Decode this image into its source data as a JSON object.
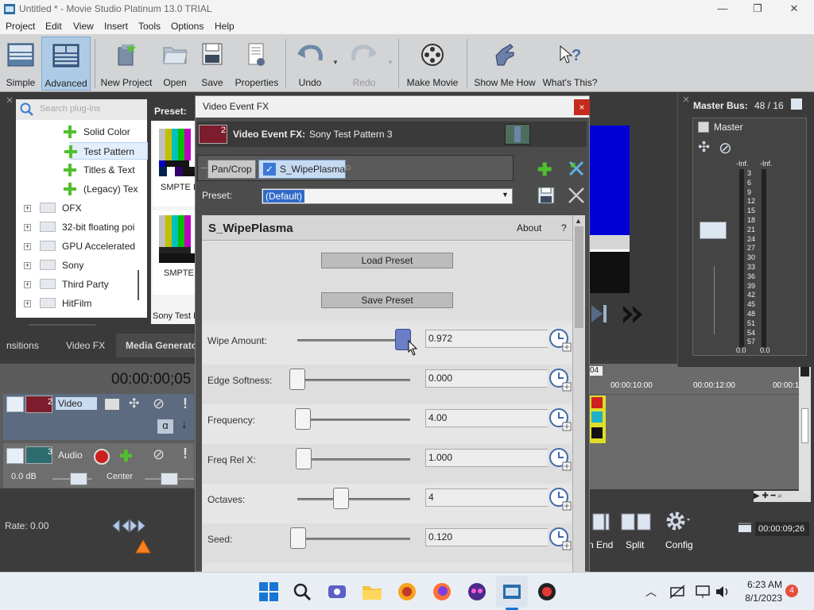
{
  "window": {
    "title": "Untitled * - Movie Studio Platinum 13.0 TRIAL",
    "controls": [
      "—",
      "❐",
      "✕"
    ]
  },
  "menu": [
    "Project",
    "Edit",
    "View",
    "Insert",
    "Tools",
    "Options",
    "Help"
  ],
  "toolbar": {
    "simple": "Simple",
    "advanced": "Advanced",
    "new_project": "New Project",
    "open": "Open",
    "save": "Save",
    "properties": "Properties",
    "undo": "Undo",
    "redo": "Redo",
    "make_movie": "Make Movie",
    "show_me_how": "Show Me How",
    "whats_this": "What's This?"
  },
  "plugins": {
    "search_placeholder": "Search plug-ins",
    "items": [
      "Solid Color",
      "Test Pattern",
      "Titles & Text",
      "(Legacy) Tex"
    ],
    "folders": [
      "OFX",
      "32-bit floating poi",
      "GPU Accelerated",
      "Sony",
      "Third Party",
      "HitFilm"
    ]
  },
  "presets_panel": {
    "label": "Preset:",
    "thumb1": "SMPTE B",
    "thumb2": "SMPTE B",
    "thumb3": "Sony Test F"
  },
  "tabs": [
    "nsitions",
    "Video FX",
    "Media Generato"
  ],
  "timeline": {
    "timecode": "00:00:00;05",
    "video_track_num": "2",
    "video_track_name": "Video",
    "audio_track_num": "3",
    "audio_track_name": "Audio",
    "volume": "0.0 dB",
    "pan": "Center",
    "alpha": "α"
  },
  "rate": "Rate: 0.00",
  "right_timeline": {
    "ruler_left": "04",
    "t1": "00:00:10:00",
    "t2": "00:00:12:00",
    "t3": "00:00:1",
    "end_timecode": "00:00:09;26"
  },
  "bottom_tools": {
    "end_label": "n End",
    "split_label": "Split",
    "config_label": "Config"
  },
  "master_bus": {
    "title": "Master Bus:",
    "count": "48 / 16",
    "master_label": "Master",
    "inf_left": "-Inf.",
    "inf_right": "-Inf.",
    "scale": [
      "3",
      "6",
      "9",
      "12",
      "15",
      "18",
      "21",
      "24",
      "27",
      "30",
      "33",
      "36",
      "39",
      "42",
      "45",
      "48",
      "51",
      "54",
      "57"
    ],
    "floor_left": "0.0",
    "floor_right": "0.0"
  },
  "dialog": {
    "title": "Video Event FX",
    "close": "×",
    "event_num": "2",
    "event_label": "Video Event FX:",
    "event_name": "Sony Test Pattern 3",
    "chain_pan_crop": "Pan/Crop",
    "chain_plugin": "S_WipePlasma",
    "preset_label": "Preset:",
    "preset_value": "(Default)",
    "plugin_name": "S_WipePlasma",
    "about": "About",
    "help": "?",
    "load_preset": "Load Preset",
    "save_preset": "Save Preset",
    "params": [
      {
        "label": "Wipe Amount:",
        "value": "0.972",
        "level": 0.972
      },
      {
        "label": "Edge Softness:",
        "value": "0.000",
        "level": 0.0
      },
      {
        "label": "Frequency:",
        "value": "4.00",
        "level": 0.05
      },
      {
        "label": "Freq Rel X:",
        "value": "1.000",
        "level": 0.06
      },
      {
        "label": "Octaves:",
        "value": "4",
        "level": 0.4
      },
      {
        "label": "Seed:",
        "value": "0.120",
        "level": 0.01
      }
    ]
  },
  "taskbar": {
    "time": "6:23 AM",
    "date": "8/1/2023",
    "badge": "4"
  }
}
